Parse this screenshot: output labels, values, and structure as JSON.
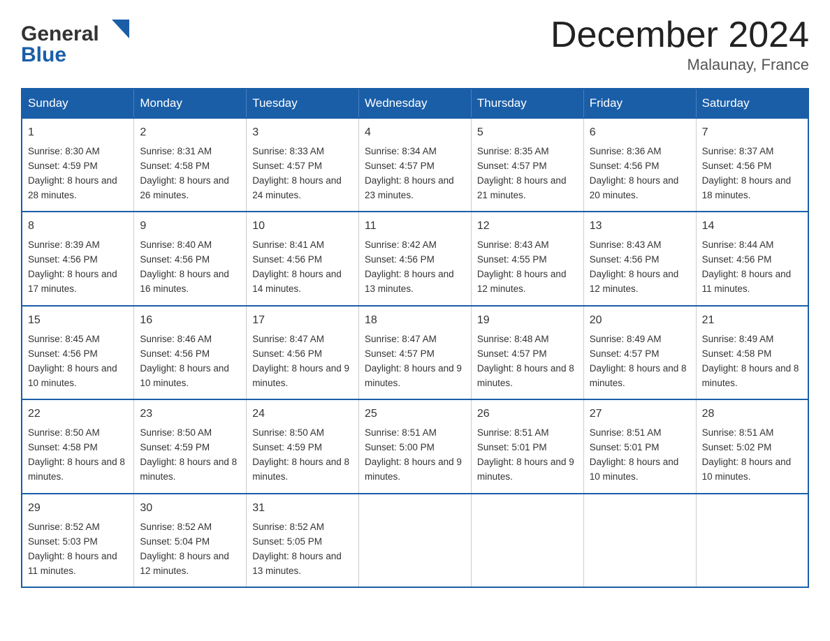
{
  "header": {
    "logo_general": "General",
    "logo_blue": "Blue",
    "month_title": "December 2024",
    "location": "Malaunay, France"
  },
  "days_of_week": [
    "Sunday",
    "Monday",
    "Tuesday",
    "Wednesday",
    "Thursday",
    "Friday",
    "Saturday"
  ],
  "weeks": [
    [
      {
        "day": "1",
        "sunrise": "8:30 AM",
        "sunset": "4:59 PM",
        "daylight": "8 hours and 28 minutes."
      },
      {
        "day": "2",
        "sunrise": "8:31 AM",
        "sunset": "4:58 PM",
        "daylight": "8 hours and 26 minutes."
      },
      {
        "day": "3",
        "sunrise": "8:33 AM",
        "sunset": "4:57 PM",
        "daylight": "8 hours and 24 minutes."
      },
      {
        "day": "4",
        "sunrise": "8:34 AM",
        "sunset": "4:57 PM",
        "daylight": "8 hours and 23 minutes."
      },
      {
        "day": "5",
        "sunrise": "8:35 AM",
        "sunset": "4:57 PM",
        "daylight": "8 hours and 21 minutes."
      },
      {
        "day": "6",
        "sunrise": "8:36 AM",
        "sunset": "4:56 PM",
        "daylight": "8 hours and 20 minutes."
      },
      {
        "day": "7",
        "sunrise": "8:37 AM",
        "sunset": "4:56 PM",
        "daylight": "8 hours and 18 minutes."
      }
    ],
    [
      {
        "day": "8",
        "sunrise": "8:39 AM",
        "sunset": "4:56 PM",
        "daylight": "8 hours and 17 minutes."
      },
      {
        "day": "9",
        "sunrise": "8:40 AM",
        "sunset": "4:56 PM",
        "daylight": "8 hours and 16 minutes."
      },
      {
        "day": "10",
        "sunrise": "8:41 AM",
        "sunset": "4:56 PM",
        "daylight": "8 hours and 14 minutes."
      },
      {
        "day": "11",
        "sunrise": "8:42 AM",
        "sunset": "4:56 PM",
        "daylight": "8 hours and 13 minutes."
      },
      {
        "day": "12",
        "sunrise": "8:43 AM",
        "sunset": "4:55 PM",
        "daylight": "8 hours and 12 minutes."
      },
      {
        "day": "13",
        "sunrise": "8:43 AM",
        "sunset": "4:56 PM",
        "daylight": "8 hours and 12 minutes."
      },
      {
        "day": "14",
        "sunrise": "8:44 AM",
        "sunset": "4:56 PM",
        "daylight": "8 hours and 11 minutes."
      }
    ],
    [
      {
        "day": "15",
        "sunrise": "8:45 AM",
        "sunset": "4:56 PM",
        "daylight": "8 hours and 10 minutes."
      },
      {
        "day": "16",
        "sunrise": "8:46 AM",
        "sunset": "4:56 PM",
        "daylight": "8 hours and 10 minutes."
      },
      {
        "day": "17",
        "sunrise": "8:47 AM",
        "sunset": "4:56 PM",
        "daylight": "8 hours and 9 minutes."
      },
      {
        "day": "18",
        "sunrise": "8:47 AM",
        "sunset": "4:57 PM",
        "daylight": "8 hours and 9 minutes."
      },
      {
        "day": "19",
        "sunrise": "8:48 AM",
        "sunset": "4:57 PM",
        "daylight": "8 hours and 8 minutes."
      },
      {
        "day": "20",
        "sunrise": "8:49 AM",
        "sunset": "4:57 PM",
        "daylight": "8 hours and 8 minutes."
      },
      {
        "day": "21",
        "sunrise": "8:49 AM",
        "sunset": "4:58 PM",
        "daylight": "8 hours and 8 minutes."
      }
    ],
    [
      {
        "day": "22",
        "sunrise": "8:50 AM",
        "sunset": "4:58 PM",
        "daylight": "8 hours and 8 minutes."
      },
      {
        "day": "23",
        "sunrise": "8:50 AM",
        "sunset": "4:59 PM",
        "daylight": "8 hours and 8 minutes."
      },
      {
        "day": "24",
        "sunrise": "8:50 AM",
        "sunset": "4:59 PM",
        "daylight": "8 hours and 8 minutes."
      },
      {
        "day": "25",
        "sunrise": "8:51 AM",
        "sunset": "5:00 PM",
        "daylight": "8 hours and 9 minutes."
      },
      {
        "day": "26",
        "sunrise": "8:51 AM",
        "sunset": "5:01 PM",
        "daylight": "8 hours and 9 minutes."
      },
      {
        "day": "27",
        "sunrise": "8:51 AM",
        "sunset": "5:01 PM",
        "daylight": "8 hours and 10 minutes."
      },
      {
        "day": "28",
        "sunrise": "8:51 AM",
        "sunset": "5:02 PM",
        "daylight": "8 hours and 10 minutes."
      }
    ],
    [
      {
        "day": "29",
        "sunrise": "8:52 AM",
        "sunset": "5:03 PM",
        "daylight": "8 hours and 11 minutes."
      },
      {
        "day": "30",
        "sunrise": "8:52 AM",
        "sunset": "5:04 PM",
        "daylight": "8 hours and 12 minutes."
      },
      {
        "day": "31",
        "sunrise": "8:52 AM",
        "sunset": "5:05 PM",
        "daylight": "8 hours and 13 minutes."
      },
      null,
      null,
      null,
      null
    ]
  ],
  "labels": {
    "sunrise": "Sunrise:",
    "sunset": "Sunset:",
    "daylight": "Daylight:"
  },
  "colors": {
    "header_bg": "#1a5ea8",
    "header_text": "#ffffff",
    "border": "#1a5ea8"
  }
}
